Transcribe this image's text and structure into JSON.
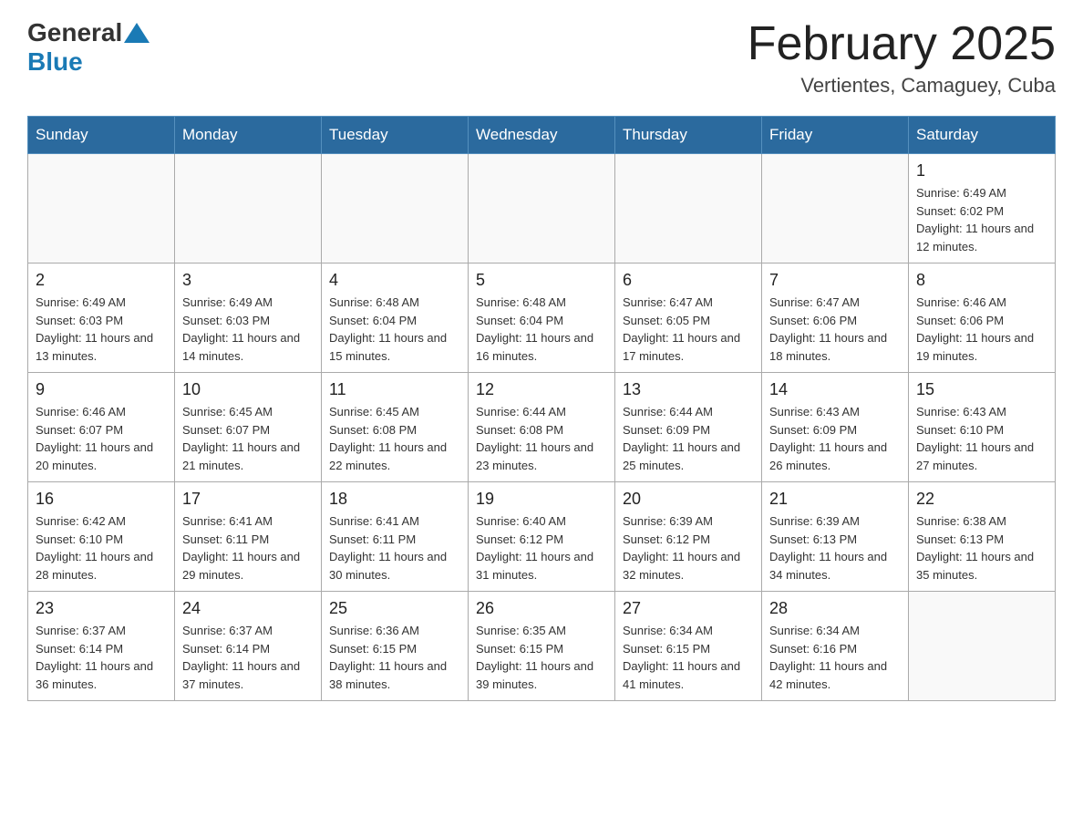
{
  "header": {
    "logo_general": "General",
    "logo_blue": "Blue",
    "month_year": "February 2025",
    "location": "Vertientes, Camaguey, Cuba"
  },
  "days_of_week": [
    "Sunday",
    "Monday",
    "Tuesday",
    "Wednesday",
    "Thursday",
    "Friday",
    "Saturday"
  ],
  "weeks": [
    [
      {
        "day": "",
        "info": ""
      },
      {
        "day": "",
        "info": ""
      },
      {
        "day": "",
        "info": ""
      },
      {
        "day": "",
        "info": ""
      },
      {
        "day": "",
        "info": ""
      },
      {
        "day": "",
        "info": ""
      },
      {
        "day": "1",
        "info": "Sunrise: 6:49 AM\nSunset: 6:02 PM\nDaylight: 11 hours and 12 minutes."
      }
    ],
    [
      {
        "day": "2",
        "info": "Sunrise: 6:49 AM\nSunset: 6:03 PM\nDaylight: 11 hours and 13 minutes."
      },
      {
        "day": "3",
        "info": "Sunrise: 6:49 AM\nSunset: 6:03 PM\nDaylight: 11 hours and 14 minutes."
      },
      {
        "day": "4",
        "info": "Sunrise: 6:48 AM\nSunset: 6:04 PM\nDaylight: 11 hours and 15 minutes."
      },
      {
        "day": "5",
        "info": "Sunrise: 6:48 AM\nSunset: 6:04 PM\nDaylight: 11 hours and 16 minutes."
      },
      {
        "day": "6",
        "info": "Sunrise: 6:47 AM\nSunset: 6:05 PM\nDaylight: 11 hours and 17 minutes."
      },
      {
        "day": "7",
        "info": "Sunrise: 6:47 AM\nSunset: 6:06 PM\nDaylight: 11 hours and 18 minutes."
      },
      {
        "day": "8",
        "info": "Sunrise: 6:46 AM\nSunset: 6:06 PM\nDaylight: 11 hours and 19 minutes."
      }
    ],
    [
      {
        "day": "9",
        "info": "Sunrise: 6:46 AM\nSunset: 6:07 PM\nDaylight: 11 hours and 20 minutes."
      },
      {
        "day": "10",
        "info": "Sunrise: 6:45 AM\nSunset: 6:07 PM\nDaylight: 11 hours and 21 minutes."
      },
      {
        "day": "11",
        "info": "Sunrise: 6:45 AM\nSunset: 6:08 PM\nDaylight: 11 hours and 22 minutes."
      },
      {
        "day": "12",
        "info": "Sunrise: 6:44 AM\nSunset: 6:08 PM\nDaylight: 11 hours and 23 minutes."
      },
      {
        "day": "13",
        "info": "Sunrise: 6:44 AM\nSunset: 6:09 PM\nDaylight: 11 hours and 25 minutes."
      },
      {
        "day": "14",
        "info": "Sunrise: 6:43 AM\nSunset: 6:09 PM\nDaylight: 11 hours and 26 minutes."
      },
      {
        "day": "15",
        "info": "Sunrise: 6:43 AM\nSunset: 6:10 PM\nDaylight: 11 hours and 27 minutes."
      }
    ],
    [
      {
        "day": "16",
        "info": "Sunrise: 6:42 AM\nSunset: 6:10 PM\nDaylight: 11 hours and 28 minutes."
      },
      {
        "day": "17",
        "info": "Sunrise: 6:41 AM\nSunset: 6:11 PM\nDaylight: 11 hours and 29 minutes."
      },
      {
        "day": "18",
        "info": "Sunrise: 6:41 AM\nSunset: 6:11 PM\nDaylight: 11 hours and 30 minutes."
      },
      {
        "day": "19",
        "info": "Sunrise: 6:40 AM\nSunset: 6:12 PM\nDaylight: 11 hours and 31 minutes."
      },
      {
        "day": "20",
        "info": "Sunrise: 6:39 AM\nSunset: 6:12 PM\nDaylight: 11 hours and 32 minutes."
      },
      {
        "day": "21",
        "info": "Sunrise: 6:39 AM\nSunset: 6:13 PM\nDaylight: 11 hours and 34 minutes."
      },
      {
        "day": "22",
        "info": "Sunrise: 6:38 AM\nSunset: 6:13 PM\nDaylight: 11 hours and 35 minutes."
      }
    ],
    [
      {
        "day": "23",
        "info": "Sunrise: 6:37 AM\nSunset: 6:14 PM\nDaylight: 11 hours and 36 minutes."
      },
      {
        "day": "24",
        "info": "Sunrise: 6:37 AM\nSunset: 6:14 PM\nDaylight: 11 hours and 37 minutes."
      },
      {
        "day": "25",
        "info": "Sunrise: 6:36 AM\nSunset: 6:15 PM\nDaylight: 11 hours and 38 minutes."
      },
      {
        "day": "26",
        "info": "Sunrise: 6:35 AM\nSunset: 6:15 PM\nDaylight: 11 hours and 39 minutes."
      },
      {
        "day": "27",
        "info": "Sunrise: 6:34 AM\nSunset: 6:15 PM\nDaylight: 11 hours and 41 minutes."
      },
      {
        "day": "28",
        "info": "Sunrise: 6:34 AM\nSunset: 6:16 PM\nDaylight: 11 hours and 42 minutes."
      },
      {
        "day": "",
        "info": ""
      }
    ]
  ]
}
